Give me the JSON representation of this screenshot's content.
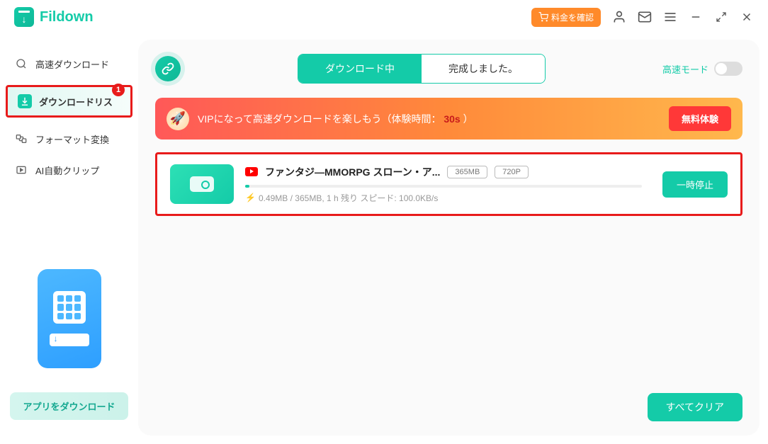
{
  "app": {
    "name": "Fildown"
  },
  "header": {
    "fee_button": "料金を確認"
  },
  "sidebar": {
    "items": [
      {
        "label": "高速ダウンロード"
      },
      {
        "label": "ダウンロードリス",
        "badge": "1"
      },
      {
        "label": "フォーマット変換"
      },
      {
        "label": "AI自動クリップ"
      }
    ],
    "app_download_btn": "アプリをダウンロード"
  },
  "main": {
    "tabs": {
      "downloading": "ダウンロード中",
      "completed": "完成しました。"
    },
    "speed_mode_label": "高速モード",
    "vip": {
      "text_prefix": "VIPになって高速ダウンロードを楽しもう（体験時間：",
      "countdown": "30s",
      "text_suffix": "）",
      "trial_btn": "無料体験"
    },
    "download": {
      "title": "ファンタジ―MMORPG スローン・ア...",
      "size_chip": "365MB",
      "quality_chip": "720P",
      "stats": "0.49MB / 365MB, 1 h 残り スピード: 100.0KB/s",
      "pause_btn": "一時停止"
    },
    "clear_all_btn": "すべてクリア"
  }
}
